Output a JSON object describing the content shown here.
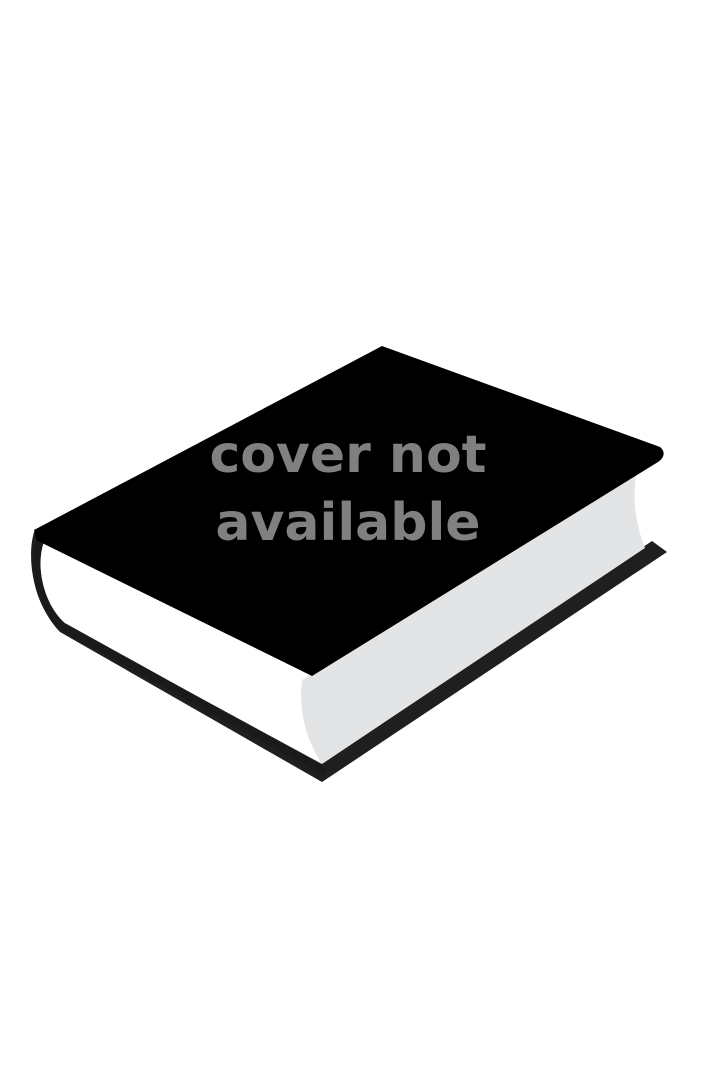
{
  "placeholder": {
    "line1": "cover not",
    "line2": "available"
  },
  "colors": {
    "background": "#ffffff",
    "cover": "#000000",
    "spine_outline": "#1a1a1a",
    "pages_front": "#ffffff",
    "pages_side": "#e3e4e6",
    "text": "#808080"
  },
  "icon": "closed-book-icon"
}
